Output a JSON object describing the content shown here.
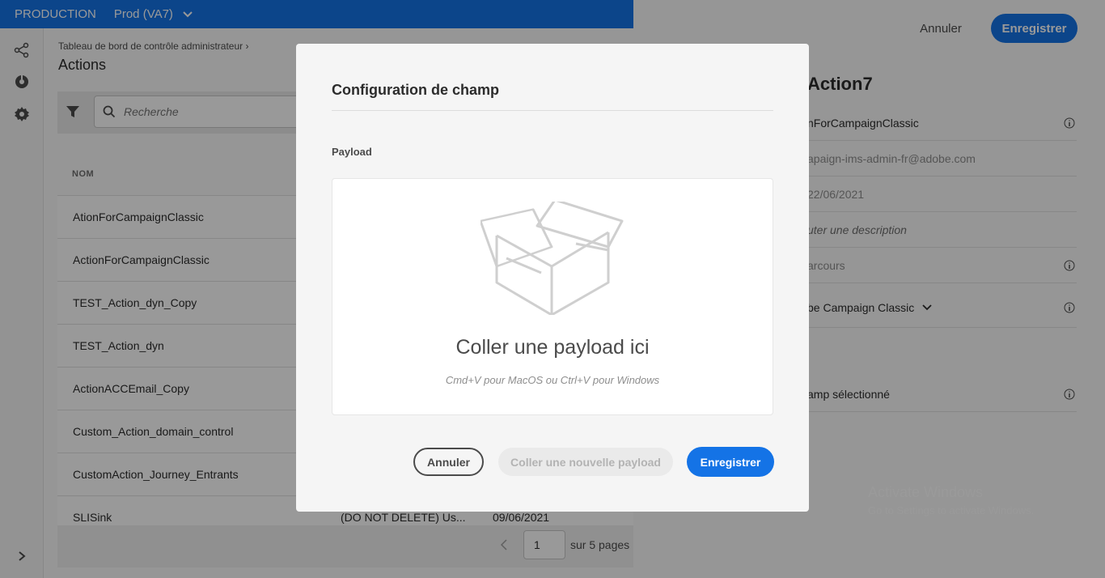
{
  "colors": {
    "brand": "#1473e6",
    "overlay": "rgba(0,0,0,0.4)"
  },
  "topbar": {
    "environment": "PRODUCTION",
    "sandbox": "Prod (VA7)"
  },
  "main": {
    "breadcrumb": "Tableau de bord de contrôle administrateur",
    "title": "Actions",
    "search_placeholder": "Recherche",
    "column_name": "NOM",
    "rows": [
      {
        "name": "AtionForCampaignClassic",
        "desc": "",
        "date": ""
      },
      {
        "name": "ActionForCampaignClassic",
        "desc": "",
        "date": ""
      },
      {
        "name": "TEST_Action_dyn_Copy",
        "desc": "",
        "date": ""
      },
      {
        "name": "TEST_Action_dyn",
        "desc": "",
        "date": ""
      },
      {
        "name": "ActionACCEmail_Copy",
        "desc": "",
        "date": ""
      },
      {
        "name": "Custom_Action_domain_control",
        "desc": "",
        "date": ""
      },
      {
        "name": "CustomAction_Journey_Entrants",
        "desc": "",
        "date": ""
      },
      {
        "name": "SLISink",
        "desc": "(DO NOT DELETE) Us...",
        "date": "09/06/2021"
      }
    ],
    "pager": {
      "page": "1",
      "of_text": "sur 5 pages"
    }
  },
  "right_panel": {
    "cancel": "Annuler",
    "save": "Enregistrer",
    "title": "Action7",
    "props": {
      "name": "nForCampaignClassic",
      "email": "apaign-ims-admin-fr@adobe.com",
      "date": "22/06/2021",
      "description": "uter une description",
      "journeys": "arcours",
      "type": "be Campaign Classic",
      "field": "amp sélectionné"
    }
  },
  "watermark": {
    "line1": "Activate Windows",
    "line2": "Go to Settings to activate Windows."
  },
  "dialog": {
    "title": "Configuration de champ",
    "label": "Payload",
    "drop_title": "Coller une payload ici",
    "drop_hint": "Cmd+V pour MacOS ou Ctrl+V pour Windows",
    "cancel": "Annuler",
    "paste_new": "Coller une nouvelle payload",
    "save": "Enregistrer"
  }
}
